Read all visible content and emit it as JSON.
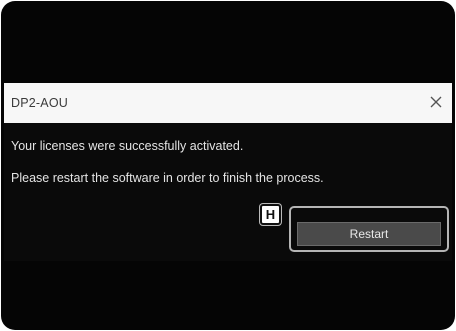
{
  "dialog": {
    "title": "DP2-AOU",
    "close_icon": "close-icon",
    "message_line1": "Your licenses were successfully activated.",
    "message_line2": "Please restart the software in order to finish the process.",
    "restart_label": "Restart"
  },
  "annotation": {
    "key_badge": "H"
  },
  "colors": {
    "background": "#050505",
    "titlebar": "#f7f7f7",
    "button": "#4a4a4a",
    "highlight_border": "#b5b5b5"
  }
}
